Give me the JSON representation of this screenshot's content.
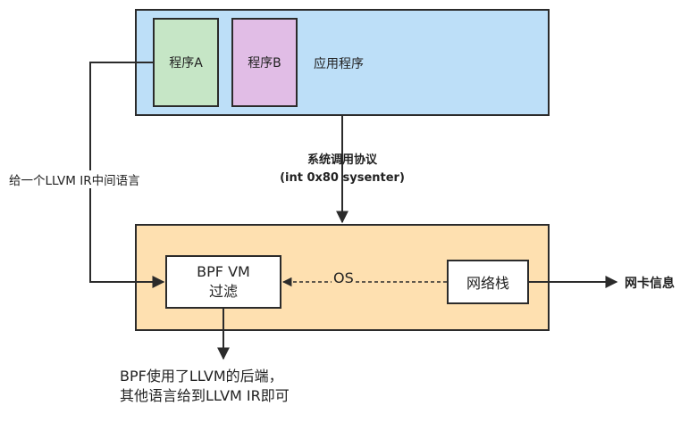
{
  "app": {
    "program_a": "程序A",
    "program_b": "程序B",
    "label": "应用程序"
  },
  "syscall": {
    "line1": "系统调用协议",
    "line2": "(int 0x80 sysenter)"
  },
  "llvm_note": "给一个LLVM IR中间语言",
  "os": {
    "label": "OS",
    "bpf_line1": "BPF VM",
    "bpf_line2": "过滤",
    "netstack": "网络栈"
  },
  "nic_label": "网卡信息",
  "footer": {
    "line1": "BPF使用了LLVM的后端，",
    "line2": "其他语言给到LLVM IR即可"
  },
  "colors": {
    "app_fill": "#bddff8",
    "program_a_fill": "#c6e6c6",
    "program_b_fill": "#e1bde6",
    "os_fill": "#fee0b0",
    "stroke": "#2b2b2b"
  }
}
